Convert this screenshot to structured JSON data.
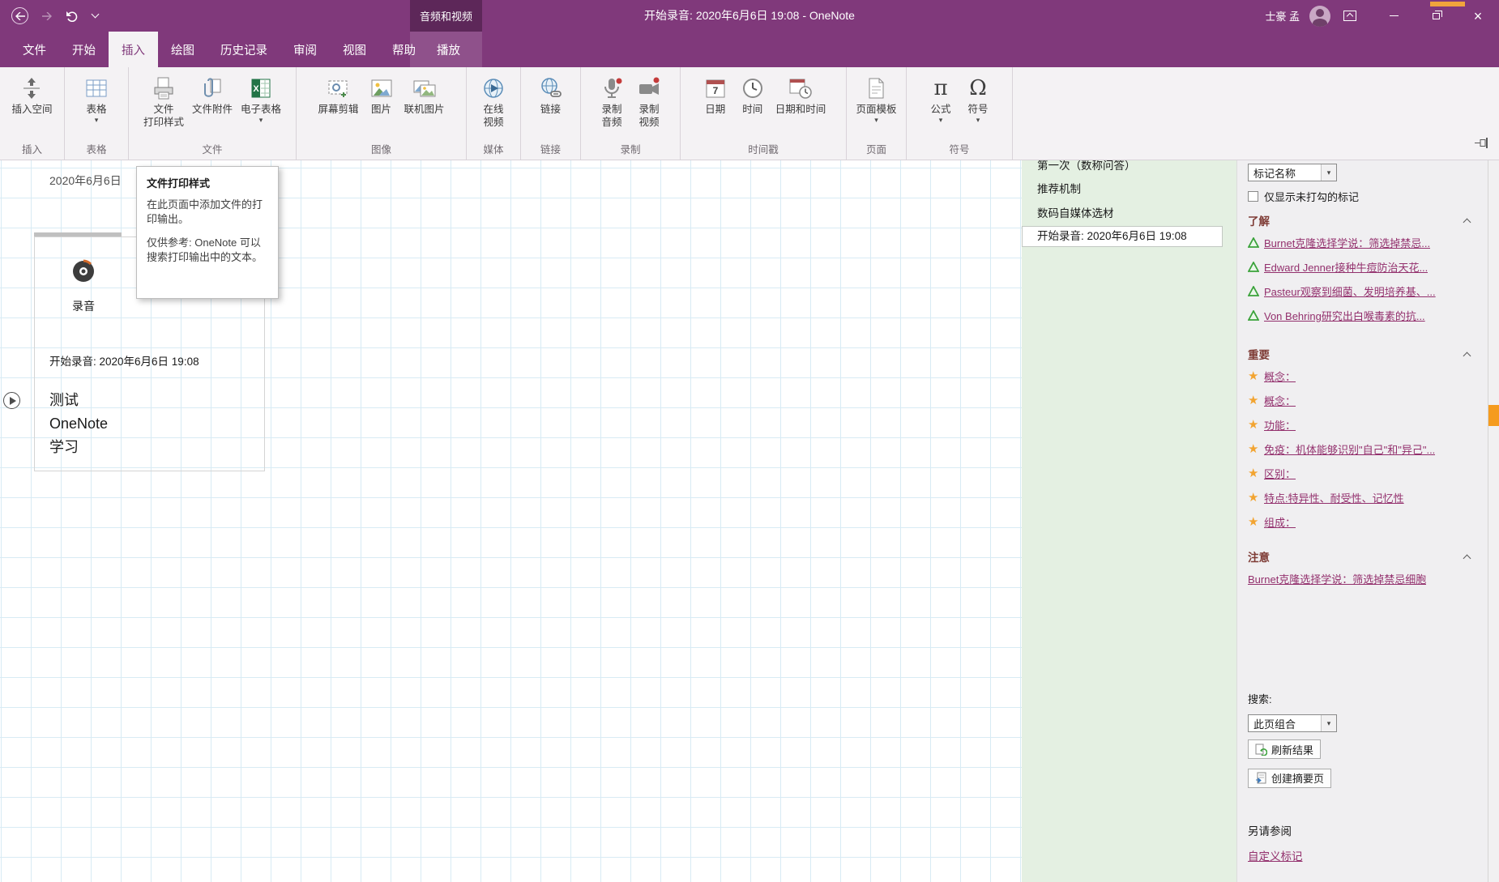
{
  "titlebar": {
    "contextual_group": "音频和视频",
    "title": "开始录音: 2020年6月6日 19:08 - OneNote",
    "user_name": "士豪 孟"
  },
  "tabs": [
    {
      "label": "文件"
    },
    {
      "label": "开始"
    },
    {
      "label": "插入"
    },
    {
      "label": "绘图"
    },
    {
      "label": "历史记录"
    },
    {
      "label": "审阅"
    },
    {
      "label": "视图"
    },
    {
      "label": "帮助"
    },
    {
      "label": "播放"
    }
  ],
  "ribbon": {
    "groups": [
      {
        "label": "插入",
        "buttons": [
          {
            "label": "插入空间"
          }
        ]
      },
      {
        "label": "表格",
        "buttons": [
          {
            "label": "表格"
          }
        ]
      },
      {
        "label": "文件",
        "buttons": [
          {
            "label": "文件",
            "label2": "打印样式"
          },
          {
            "label": "文件附件"
          },
          {
            "label": "电子表格"
          }
        ]
      },
      {
        "label": "图像",
        "buttons": [
          {
            "label": "屏幕剪辑"
          },
          {
            "label": "图片"
          },
          {
            "label": "联机图片"
          }
        ]
      },
      {
        "label": "媒体",
        "buttons": [
          {
            "label": "在线",
            "label2": "视频"
          }
        ]
      },
      {
        "label": "链接",
        "buttons": [
          {
            "label": "链接"
          }
        ]
      },
      {
        "label": "录制",
        "buttons": [
          {
            "label": "录制",
            "label2": "音频"
          },
          {
            "label": "录制",
            "label2": "视频"
          }
        ]
      },
      {
        "label": "时间戳",
        "buttons": [
          {
            "label": "日期"
          },
          {
            "label": "时间"
          },
          {
            "label": "日期和时间"
          }
        ]
      },
      {
        "label": "页面",
        "buttons": [
          {
            "label": "页面模板"
          }
        ]
      },
      {
        "label": "符号",
        "buttons": [
          {
            "label": "公式"
          },
          {
            "label": "符号"
          }
        ]
      }
    ]
  },
  "tooltip": {
    "title": "文件打印样式",
    "body": "在此页面中添加文件的打印输出。",
    "note": "仅供参考: OneNote 可以搜索打印输出中的文本。"
  },
  "canvas": {
    "date": "2020年6月6日",
    "recording_label": "录音",
    "recording_caption": "开始录音: 2020年6月6日 19:08",
    "note_lines": [
      "测试",
      "OneNote",
      "学习"
    ]
  },
  "page_list": {
    "items": [
      {
        "title": "第一次（数称问答）"
      },
      {
        "title": "推荐机制"
      },
      {
        "title": "数码自媒体选材"
      },
      {
        "title": "开始录音: 2020年6月6日 19:08"
      }
    ]
  },
  "tags_panel": {
    "group_dropdown": "标记名称",
    "checkbox_label": "仅显示未打勾的标记",
    "sections": [
      {
        "title": "了解",
        "items": [
          "Burnet克隆选择学说：筛选掉禁忌...",
          "Edward Jenner接种牛痘防治天花...",
          "Pasteur观察到细菌、发明培养基、...",
          "Von Behring研究出白喉毒素的抗..."
        ]
      },
      {
        "title": "重要",
        "items": [
          "概念：",
          "概念：",
          "功能：",
          "免疫：机体能够识别\"自己\"和\"异己\"...",
          "区别：",
          "特点:特异性、耐受性、记忆性",
          "组成："
        ]
      },
      {
        "title": "注意",
        "items": [
          "Burnet克隆选择学说：筛选掉禁忌细胞"
        ]
      }
    ],
    "search_label": "搜索:",
    "search_scope": "此页组合",
    "refresh_button": "刷新结果",
    "create_summary_button": "创建摘要页",
    "see_also": "另请参阅",
    "customize_link": "自定义标记"
  },
  "colors": {
    "accent": "#80397B",
    "accent-dark": "#5d2759",
    "ribbon-bg": "#f4f2f4",
    "grid-line": "#d8ebf4",
    "page-list-bg": "#e4f0e2",
    "tags-bg": "#f0eff1",
    "link": "#93306d",
    "section-header": "#7e3b35",
    "star": "#f2a431",
    "triangle": "#3aa23a",
    "scroll-marker": "#f59b1e"
  }
}
